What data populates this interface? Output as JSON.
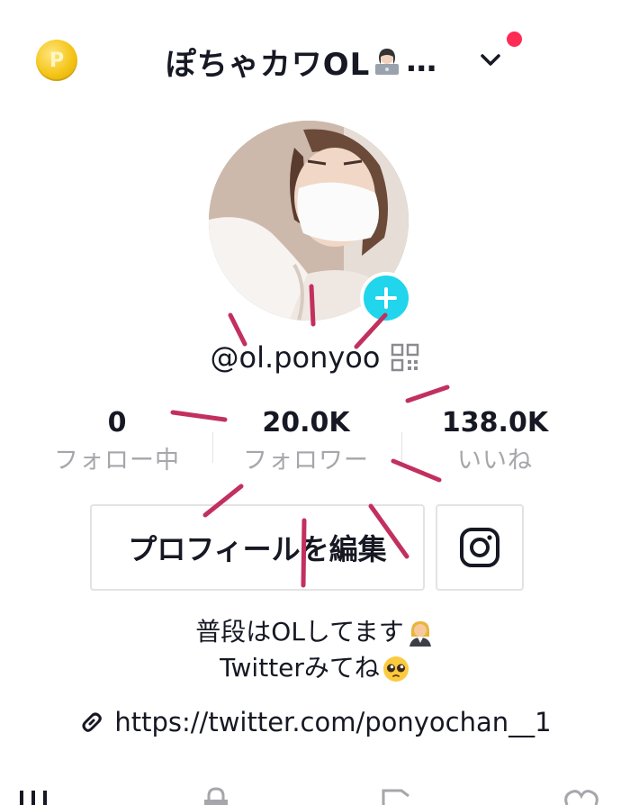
{
  "header": {
    "coin_symbol": "P",
    "title": "ぽちゃカワOL",
    "title_emoji": "woman-technologist-emoji",
    "title_ellipsis": "…",
    "dropdown_icon": "chevron-down-icon",
    "notification_color": "#fe2c55"
  },
  "profile": {
    "avatar_add_icon": "plus-icon",
    "avatar_add_color": "#20d5ec",
    "username": "@ol.ponyoo",
    "qr_icon": "qr-code-icon"
  },
  "stats": [
    {
      "value": "0",
      "label": "フォロー中"
    },
    {
      "value": "20.0K",
      "label": "フォロワー"
    },
    {
      "value": "138.0K",
      "label": "いいね"
    }
  ],
  "buttons": {
    "edit_profile": "プロフィールを編集",
    "instagram_icon": "instagram-icon"
  },
  "bio": {
    "line1": "普段はOLしてます",
    "line1_emoji": "woman-office-worker-emoji",
    "line2": "Twitterみてね",
    "line2_emoji": "pleading-face-emoji"
  },
  "link": {
    "icon": "link-icon",
    "url": "https://twitter.com/ponyochan__1"
  },
  "tabs": {
    "icons": [
      "grid-icon",
      "lock-icon",
      "repost-icon",
      "heart-icon"
    ]
  },
  "annotation_color": "#c2305f"
}
